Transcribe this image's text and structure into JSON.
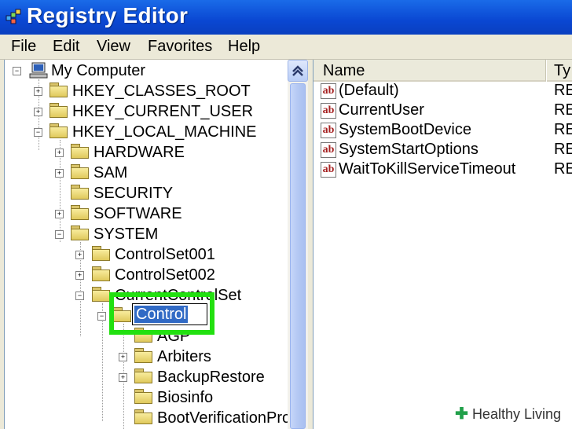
{
  "window": {
    "title": "Registry Editor"
  },
  "menu": [
    "File",
    "Edit",
    "View",
    "Favorites",
    "Help"
  ],
  "tree": {
    "root": "My Computer",
    "items": [
      {
        "label": "HKEY_CLASSES_ROOT",
        "expander": "+"
      },
      {
        "label": "HKEY_CURRENT_USER",
        "expander": "+"
      },
      {
        "label": "HKEY_LOCAL_MACHINE",
        "expander": "-"
      },
      {
        "label": "HARDWARE",
        "expander": "+"
      },
      {
        "label": "SAM",
        "expander": "+"
      },
      {
        "label": "SECURITY",
        "expander": ""
      },
      {
        "label": "SOFTWARE",
        "expander": "+"
      },
      {
        "label": "SYSTEM",
        "expander": "-"
      },
      {
        "label": "ControlSet001",
        "expander": "+"
      },
      {
        "label": "ControlSet002",
        "expander": "+"
      },
      {
        "label": "CurrentControlSet",
        "expander": "-"
      },
      {
        "label": "Control",
        "expander": "-"
      },
      {
        "label": "AGP",
        "expander": ""
      },
      {
        "label": "Arbiters",
        "expander": "+"
      },
      {
        "label": "BackupRestore",
        "expander": "+"
      },
      {
        "label": "Biosinfo",
        "expander": ""
      },
      {
        "label": "BootVerificationPro",
        "expander": ""
      }
    ]
  },
  "rename": {
    "value": "Control"
  },
  "list": {
    "columns": {
      "name": "Name",
      "type": "Ty"
    },
    "values": [
      {
        "name": "(Default)",
        "type": "RE"
      },
      {
        "name": "CurrentUser",
        "type": "RE"
      },
      {
        "name": "SystemBootDevice",
        "type": "RE"
      },
      {
        "name": "SystemStartOptions",
        "type": "RE"
      },
      {
        "name": "WaitToKillServiceTimeout",
        "type": "RE"
      }
    ],
    "value_icon_text": "ab"
  },
  "watermark": {
    "text": "Healthy Living"
  },
  "colors": {
    "titlebar": "#0a47d2",
    "highlight": "#22e010",
    "selection": "#316ac5"
  }
}
